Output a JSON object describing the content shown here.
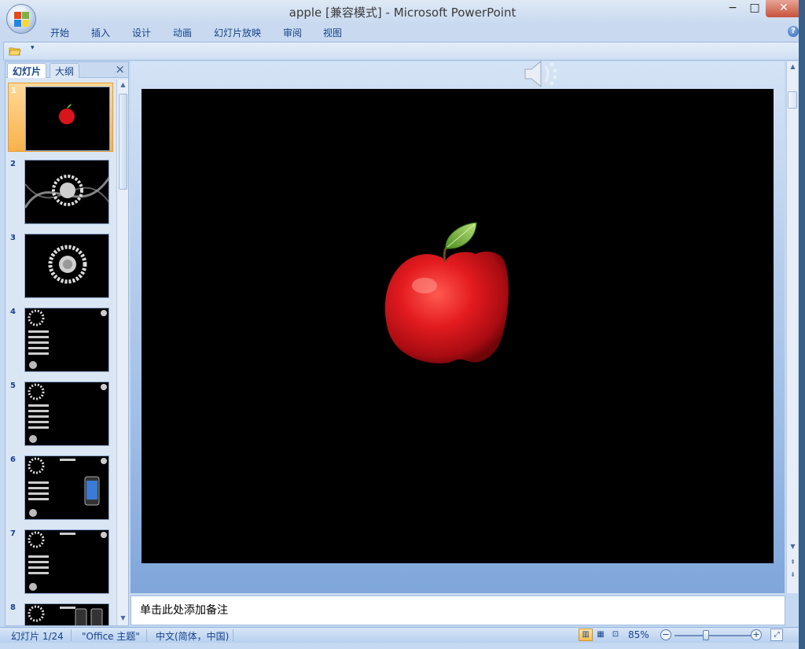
{
  "window": {
    "title": "apple [兼容模式] - Microsoft PowerPoint",
    "minimize": "−",
    "maximize": "□",
    "close": "✕"
  },
  "ribbon": {
    "tabs": [
      "开始",
      "插入",
      "设计",
      "动画",
      "幻灯片放映",
      "审阅",
      "视图"
    ],
    "help": "?"
  },
  "quick_access": {
    "dropdown": "▾"
  },
  "left_panel": {
    "tab_slides": "幻灯片",
    "tab_outline": "大纲",
    "close": "×",
    "slides": [
      {
        "num": "1",
        "content": "apple",
        "selected": true
      },
      {
        "num": "2",
        "content": "snowflake-swirl"
      },
      {
        "num": "3",
        "content": "snowflake"
      },
      {
        "num": "4",
        "content": "iphone-list"
      },
      {
        "num": "5",
        "content": "iphone-list"
      },
      {
        "num": "6",
        "content": "iphone-list-phone"
      },
      {
        "num": "7",
        "content": "iphone-list"
      },
      {
        "num": "8",
        "content": "iphone-phones"
      }
    ]
  },
  "notes": {
    "placeholder": "单击此处添加备注"
  },
  "status": {
    "slide_counter": "幻灯片 1/24",
    "theme": "\"Office 主题\"",
    "language": "中文(简体，中国)",
    "zoom": "85%",
    "zoom_fraction": 0.4
  },
  "colors": {
    "accent": "#15428b",
    "slide_bg": "#000000",
    "apple_red": "#d8141c",
    "leaf_green": "#6fb43a"
  }
}
